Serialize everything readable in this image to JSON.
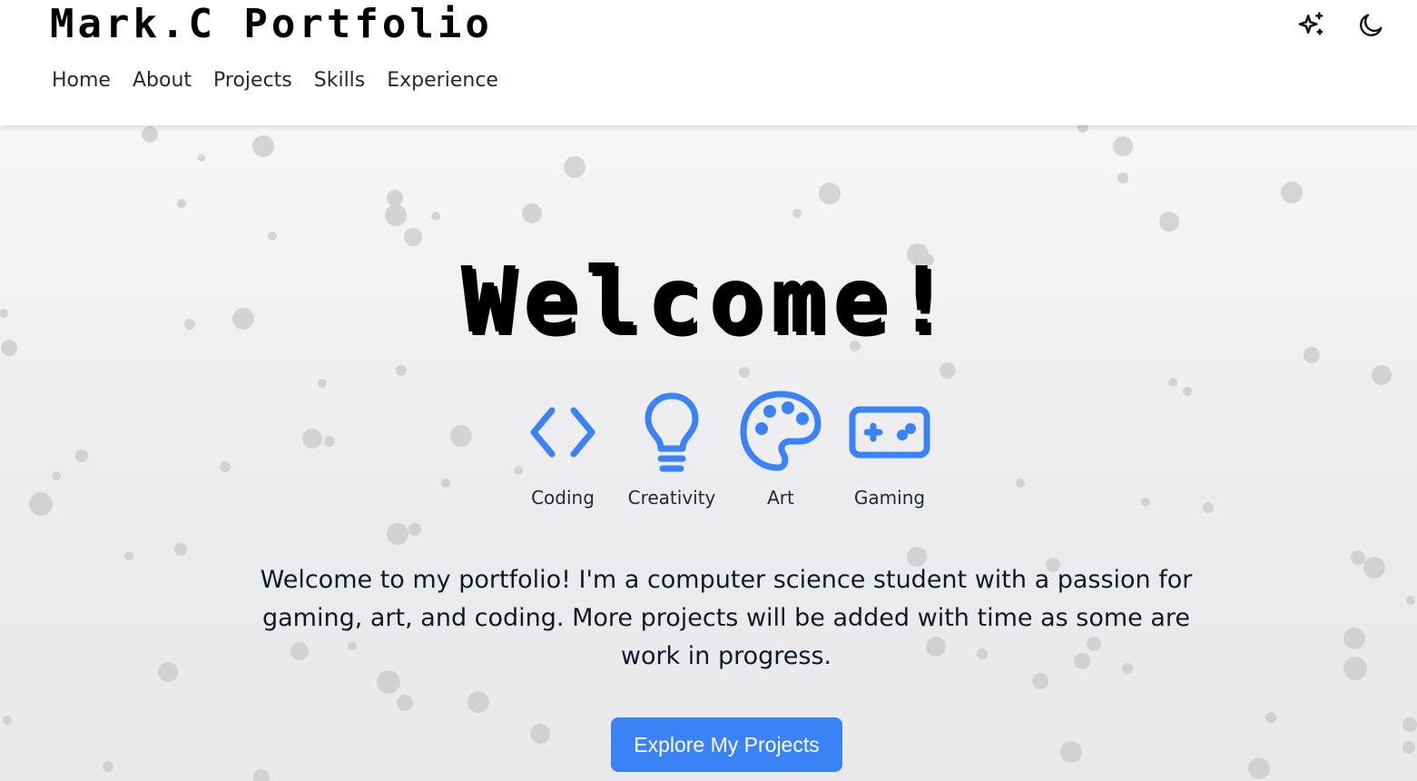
{
  "header": {
    "brand": "Mark.C Portfolio",
    "nav": [
      "Home",
      "About",
      "Projects",
      "Skills",
      "Experience"
    ],
    "icons": [
      "sparkles-icon",
      "moon-icon"
    ]
  },
  "hero": {
    "title": "Welcome!",
    "interests": [
      {
        "label": "Coding",
        "icon": "code-brackets-icon"
      },
      {
        "label": "Creativity",
        "icon": "lightbulb-icon"
      },
      {
        "label": "Art",
        "icon": "palette-icon"
      },
      {
        "label": "Gaming",
        "icon": "gamepad-icon"
      }
    ],
    "intro": "Welcome to my portfolio! I'm a computer science student with a passion for gaming, art, and coding. More projects will be added with time as some are work in progress.",
    "cta_label": "Explore My Projects"
  },
  "colors": {
    "accent": "#3b82f6",
    "text": "#111827",
    "background": "#ececee"
  }
}
